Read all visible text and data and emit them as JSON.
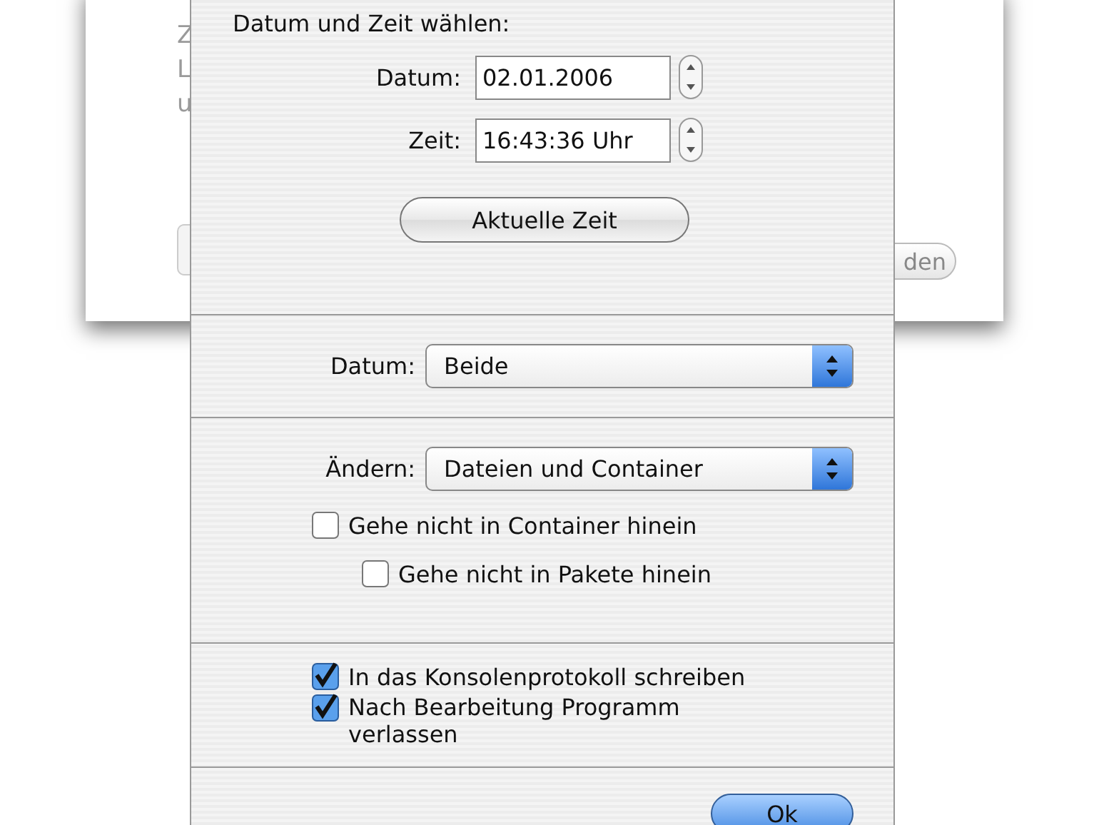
{
  "background_window": {
    "text_fragments": [
      "Z",
      "L",
      "u"
    ],
    "button": "den"
  },
  "sheet": {
    "heading": "Datum und Zeit wählen:",
    "fields": [
      {
        "label": "Datum:",
        "value": "02.01.2006"
      },
      {
        "label": "Zeit:",
        "value": "16:43:36 Uhr"
      }
    ],
    "current_time_button": "Aktuelle Zeit",
    "date_popup": {
      "label": "Datum:",
      "value": "Beide"
    },
    "change_popup": {
      "label": "Ändern:",
      "value": "Dateien und Container"
    },
    "options": [
      {
        "label": "Gehe nicht in Container hinein",
        "checked": false,
        "children": [
          {
            "label": "Gehe nicht in Pakete hinein",
            "checked": false
          }
        ]
      }
    ],
    "logging": [
      {
        "label": "In das Konsolenprotokoll schreiben",
        "checked": true
      },
      {
        "label": "Nach Bearbeitung Programm verlassen",
        "checked": true
      }
    ],
    "ok_button": "Ok"
  }
}
